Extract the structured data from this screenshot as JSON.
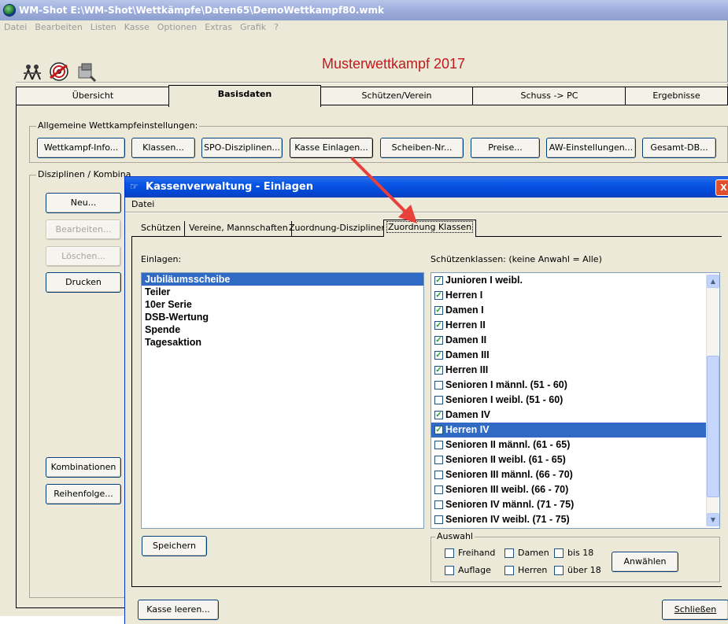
{
  "main_window": {
    "title": "WM-Shot E:\\WM-Shot\\Wettkämpfe\\Daten65\\DemoWettkampf80.wmk",
    "menu": [
      "Datei",
      "Bearbeiten",
      "Listen",
      "Kasse",
      "Optionen",
      "Extras",
      "Grafik",
      "?"
    ],
    "toolbar_icons": [
      "shooters-icon",
      "target-icon",
      "tools-icon"
    ],
    "header": "Musterwettkampf 2017",
    "tabs": [
      "Übersicht",
      "Basisdaten",
      "Schützen/Verein",
      "Schuss -> PC",
      "Ergebnisse"
    ],
    "active_tab": "Basisdaten",
    "general": {
      "legend": "Allgemeine Wettkampfeinstellungen:",
      "buttons": [
        "Wettkampf-Info...",
        "Klassen...",
        "SPO-Disziplinen...",
        "Kasse Einlagen...",
        "Scheiben-Nr...",
        "Preise...",
        "AW-Einstellungen...",
        "Gesamt-DB..."
      ]
    },
    "disciplines": {
      "legend": "Disziplinen / Kombina",
      "new": "Neu...",
      "edit": "Bearbeiten...",
      "delete": "Löschen...",
      "print": "Drucken",
      "combinations": "Kombinationen",
      "order": "Reihenfolge..."
    }
  },
  "dialog": {
    "title": "Kassenverwaltung - Einlagen",
    "close": "X",
    "menu": [
      "Datei"
    ],
    "tabs": [
      "Schützen",
      "Vereine, Mannschaften",
      "Zuordnung-Disziplinen",
      "Zuordnung Klassen"
    ],
    "active_tab": "Zuordnung Klassen",
    "einlagen": {
      "label": "Einlagen:",
      "items": [
        "Jubiläumsscheibe",
        "Teiler",
        "10er Serie",
        "DSB-Wertung",
        "Spende",
        "Tagesaktion"
      ],
      "selected_index": 0
    },
    "klassen": {
      "label": "Schützenklassen: (keine Anwahl = Alle)",
      "items": [
        {
          "label": "Junioren I weibl.",
          "checked": true
        },
        {
          "label": "Herren I",
          "checked": true
        },
        {
          "label": "Damen I",
          "checked": true
        },
        {
          "label": "Herren II",
          "checked": true
        },
        {
          "label": "Damen II",
          "checked": true
        },
        {
          "label": "Damen III",
          "checked": true
        },
        {
          "label": "Herren III",
          "checked": true
        },
        {
          "label": "Senioren I männl. (51 - 60)",
          "checked": false
        },
        {
          "label": "Senioren I weibl. (51 - 60)",
          "checked": false
        },
        {
          "label": "Damen IV",
          "checked": true
        },
        {
          "label": "Herren IV",
          "checked": true
        },
        {
          "label": "Senioren II männl. (61 - 65)",
          "checked": false
        },
        {
          "label": "Senioren II weibl. (61 - 65)",
          "checked": false
        },
        {
          "label": "Senioren III männl. (66 - 70)",
          "checked": false
        },
        {
          "label": "Senioren III weibl. (66 - 70)",
          "checked": false
        },
        {
          "label": "Senioren IV männl. (71 - 75)",
          "checked": false
        },
        {
          "label": "Senioren IV weibl. (71 - 75)",
          "checked": false
        }
      ],
      "selected_index": 10
    },
    "save": "Speichern",
    "auswahl": {
      "legend": "Auswahl",
      "options": [
        "Freihand",
        "Damen",
        "bis 18",
        "Auflage",
        "Herren",
        "über 18"
      ],
      "select_button": "Anwählen"
    },
    "clear": "Kasse leeren...",
    "close_button": "Schließen"
  },
  "colors": {
    "header_red": "#c11a1a",
    "dialog_title_blue": "#0a58e6",
    "selection_blue": "#316ac5",
    "annotation_arrow": "#e8413c"
  }
}
